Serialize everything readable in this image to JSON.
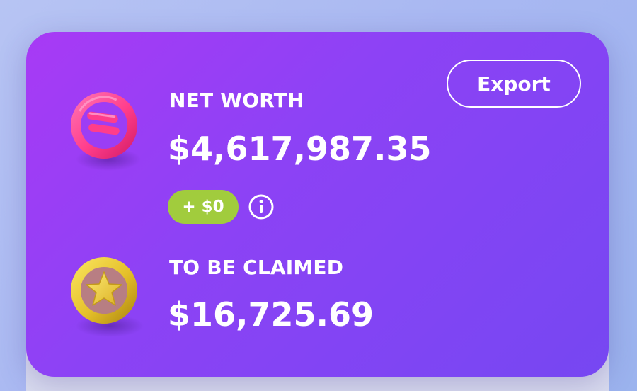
{
  "card": {
    "export_label": "Export",
    "net_worth": {
      "label": "NET WORTH",
      "amount": "$4,617,987.35",
      "change": "+ $0",
      "coin_icon": "pink-ring-coin-icon"
    },
    "to_be_claimed": {
      "label": "TO BE CLAIMED",
      "amount": "$16,725.69",
      "coin_icon": "gold-star-coin-icon"
    }
  },
  "colors": {
    "card_gradient_start": "#a83af5",
    "card_gradient_end": "#7647f2",
    "badge_green": "#a1cc3d",
    "coin_pink": "#ff3d8b",
    "coin_gold": "#e5c02a",
    "page_background": "#a9b8f2"
  },
  "icons": {
    "info": "info-circle-icon"
  }
}
